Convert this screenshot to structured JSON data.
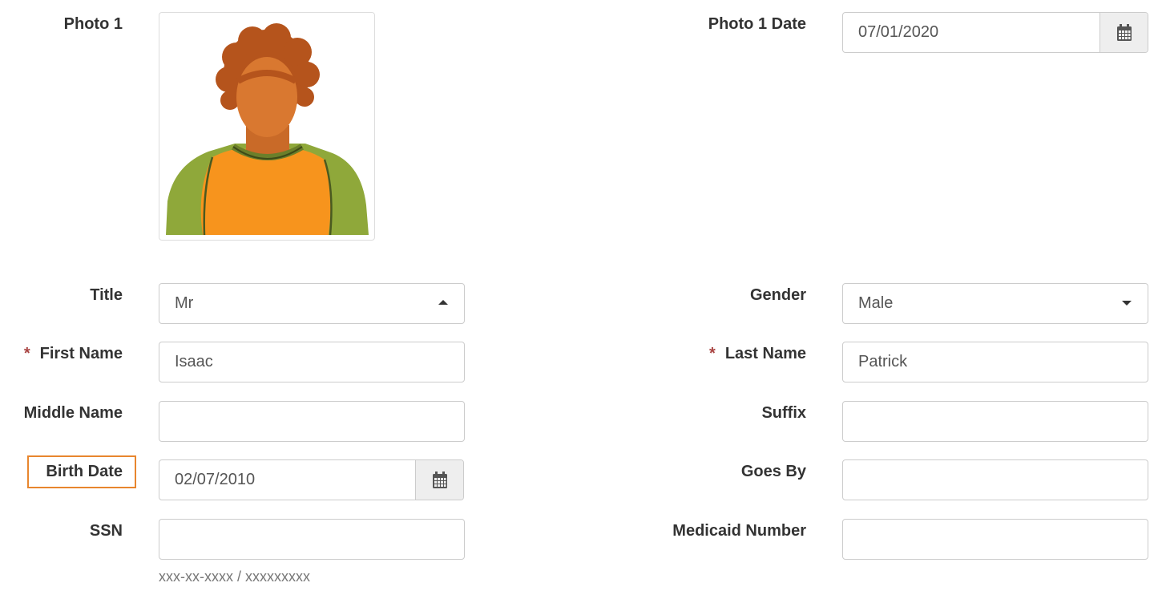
{
  "photo": {
    "label": "Photo 1",
    "date_label": "Photo 1 Date",
    "date_value": "07/01/2020"
  },
  "title": {
    "label": "Title",
    "value": "Mr"
  },
  "gender": {
    "label": "Gender",
    "value": "Male"
  },
  "first_name": {
    "label": "First Name",
    "required_mark": "*",
    "value": "Isaac"
  },
  "last_name": {
    "label": "Last Name",
    "required_mark": "*",
    "value": "Patrick"
  },
  "middle_name": {
    "label": "Middle Name",
    "value": ""
  },
  "suffix": {
    "label": "Suffix",
    "value": ""
  },
  "birth_date": {
    "label": "Birth Date",
    "value": "02/07/2010"
  },
  "goes_by": {
    "label": "Goes By",
    "value": ""
  },
  "ssn": {
    "label": "SSN",
    "value": "",
    "hint": "xxx-xx-xxxx / xxxxxxxxx"
  },
  "medicaid": {
    "label": "Medicaid Number",
    "value": ""
  },
  "icons": {
    "calendar": "calendar-icon",
    "caret_up": "caret-up-icon",
    "caret_down": "caret-down-icon",
    "photo": "person-avatar-icon"
  },
  "colors": {
    "highlight": "#e8862e",
    "required": "#a94442",
    "shirt": "#f7941d",
    "sleeves": "#8fa83a",
    "skin": "#d97830",
    "hair": "#b5541c"
  }
}
